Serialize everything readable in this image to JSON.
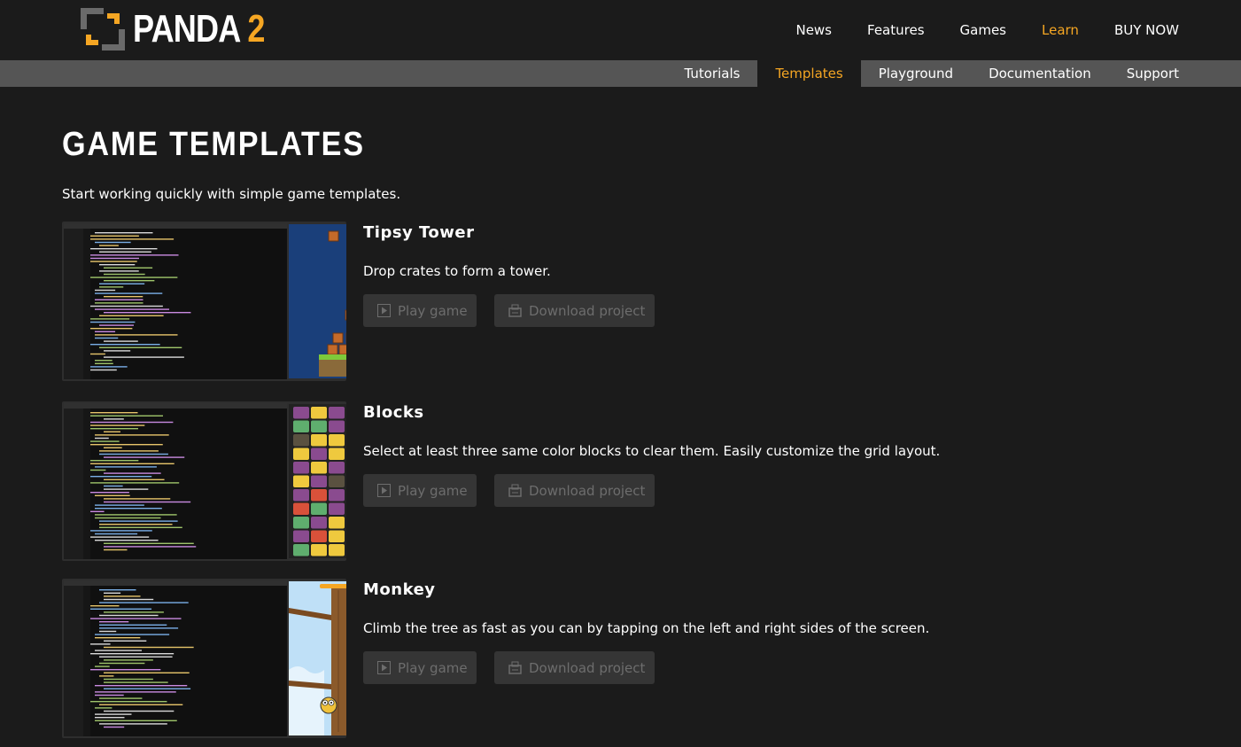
{
  "brand": {
    "name_part1": "PANDA",
    "name_part2": "2",
    "accent": "#f5a623"
  },
  "main_nav": [
    {
      "label": "News",
      "active": false
    },
    {
      "label": "Features",
      "active": false
    },
    {
      "label": "Games",
      "active": false
    },
    {
      "label": "Learn",
      "active": true
    },
    {
      "label": "BUY NOW",
      "active": false
    }
  ],
  "sub_nav": [
    {
      "label": "Tutorials",
      "active": false
    },
    {
      "label": "Templates",
      "active": true
    },
    {
      "label": "Playground",
      "active": false
    },
    {
      "label": "Documentation",
      "active": false
    },
    {
      "label": "Support",
      "active": false
    }
  ],
  "page": {
    "title": "GAME TEMPLATES",
    "intro": "Start working quickly with simple game templates."
  },
  "templates": [
    {
      "title": "Tipsy Tower",
      "description": "Drop crates to form a tower.",
      "play_label": "Play game",
      "download_label": "Download project",
      "play_icon": "play-icon",
      "download_icon": "download-icon"
    },
    {
      "title": "Blocks",
      "description": "Select at least three same color blocks to clear them. Easily customize the grid layout.",
      "play_label": "Play game",
      "download_label": "Download project",
      "play_icon": "play-icon",
      "download_icon": "download-icon"
    },
    {
      "title": "Monkey",
      "description": "Climb the tree as fast as you can by tapping on the left and right sides of the screen.",
      "play_label": "Play game",
      "download_label": "Download project",
      "play_icon": "play-icon",
      "download_icon": "download-icon"
    }
  ],
  "colors": {
    "background": "#1b1b1b",
    "subnav_bar": "#555555",
    "button_bg": "#353535",
    "button_text": "#6d6d6d",
    "tower_bg": "#1a3f7a",
    "block_colors": [
      "#8a4b8f",
      "#efc93e",
      "#5fae6e",
      "#5a5140",
      "#d9513a"
    ]
  }
}
